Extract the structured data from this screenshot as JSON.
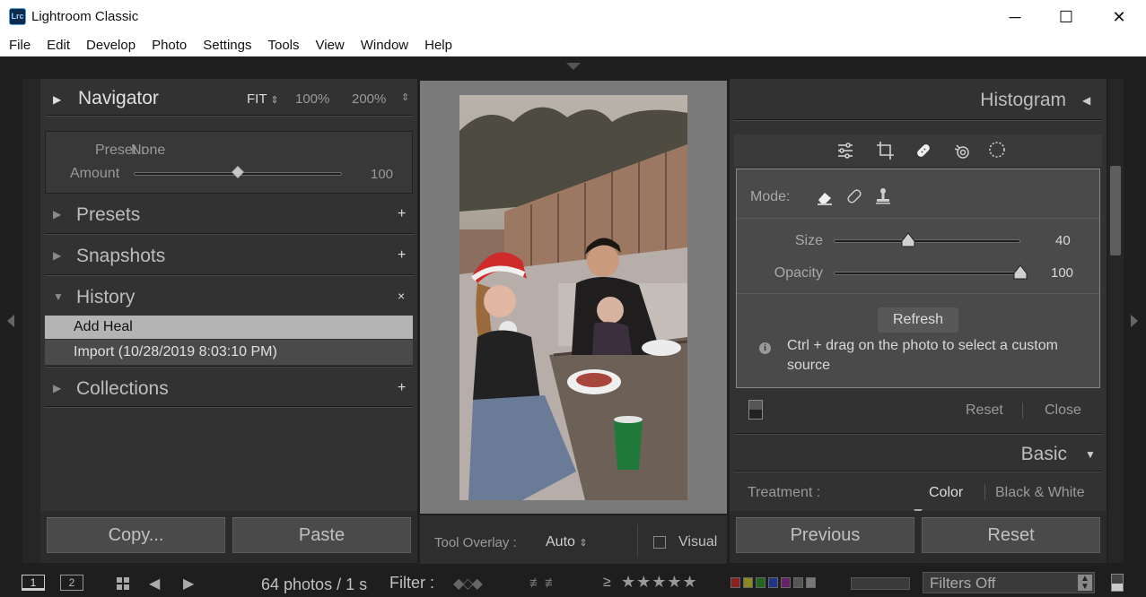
{
  "window": {
    "title": "Lightroom Classic",
    "logo": "Lrc",
    "minimize": "─",
    "maximize": "☐",
    "close": "✕"
  },
  "menu": [
    "File",
    "Edit",
    "Develop",
    "Photo",
    "Settings",
    "Tools",
    "View",
    "Window",
    "Help"
  ],
  "left": {
    "navigator": {
      "title": "Navigator",
      "zoom": [
        "FIT",
        "100%",
        "200%"
      ]
    },
    "preset": {
      "preset_label": "Preset :",
      "preset_value": "None",
      "amount_label": "Amount",
      "amount_value": "100",
      "amount_fraction": 0.5
    },
    "panels": {
      "presets": "Presets",
      "snapshots": "Snapshots",
      "history": "History",
      "collections": "Collections"
    },
    "history_items": [
      "Add Heal",
      "Import (10/28/2019 8:03:10 PM)"
    ],
    "copy": "Copy...",
    "paste": "Paste"
  },
  "center": {
    "tool_overlay_label": "Tool Overlay :",
    "tool_overlay_value": "Auto",
    "visual_label": "Visual"
  },
  "right": {
    "histogram": "Histogram",
    "mode_label": "Mode:",
    "size_label": "Size",
    "size_value": "40",
    "size_fraction": 0.4,
    "opacity_label": "Opacity",
    "opacity_value": "100",
    "opacity_fraction": 1.0,
    "refresh": "Refresh",
    "hint": "Ctrl + drag on the photo to select a custom source",
    "reset": "Reset",
    "close": "Close",
    "basic": "Basic",
    "treatment_label": "Treatment :",
    "color": "Color",
    "bw": "Black & White",
    "previous": "Previous",
    "reset_btn": "Reset"
  },
  "filmstrip": {
    "page1": "1",
    "page2": "2",
    "photos": "64 photos / 1 s",
    "filter_label": "Filter :",
    "ge": "≥",
    "stars": "★★★★★",
    "filters_off": "Filters Off"
  },
  "colors": {
    "accent": "#cfcfcf",
    "panel": "#323232",
    "bg": "#1f1f1f"
  }
}
